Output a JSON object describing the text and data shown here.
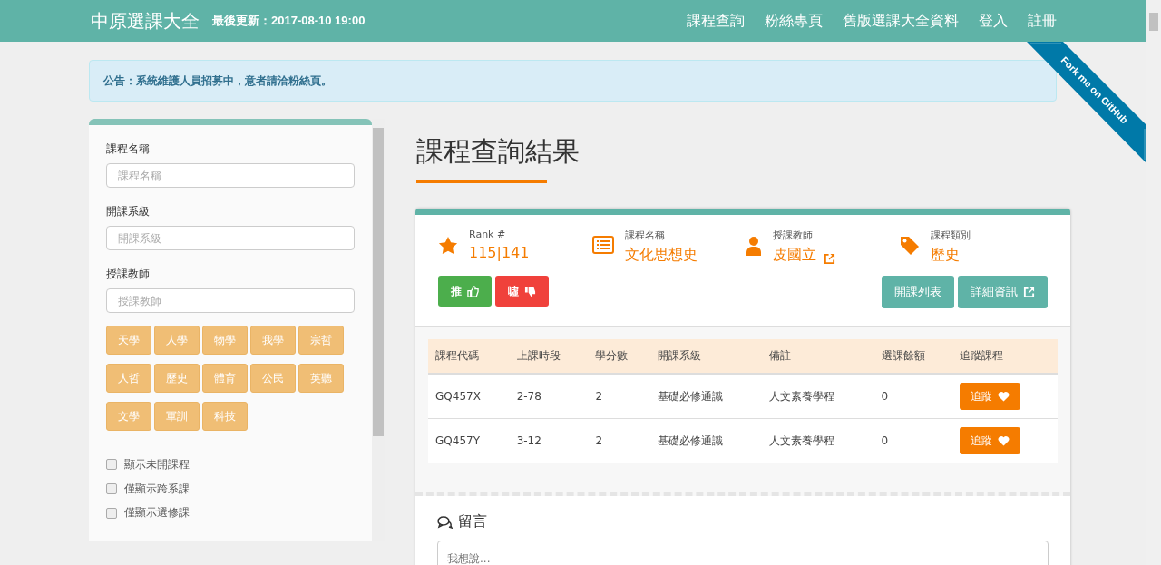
{
  "navbar": {
    "brand": "中原選課大全",
    "updated": "最後更新：2017-08-10 19:00",
    "links": [
      "課程查詢",
      "粉絲專頁",
      "舊版選課大全資料",
      "登入",
      "註冊"
    ]
  },
  "ribbon": {
    "text": "Fork me on GitHub"
  },
  "notice": "公告：系統維護人員招募中，意者請洽粉絲頁。",
  "sidebar": {
    "fields": [
      {
        "label": "課程名稱",
        "placeholder": "課程名稱"
      },
      {
        "label": "開課系級",
        "placeholder": "開課系級"
      },
      {
        "label": "授課教師",
        "placeholder": "授課教師"
      }
    ],
    "tags": [
      "天學",
      "人學",
      "物學",
      "我學",
      "宗哲",
      "人哲",
      "歷史",
      "體育",
      "公民",
      "英聽",
      "文學",
      "軍訓",
      "科技"
    ],
    "checkboxes": [
      {
        "label": "顯示未開課程",
        "checked": false
      },
      {
        "label": "僅顯示跨系課",
        "checked": false
      },
      {
        "label": "僅顯示選修課",
        "checked": false
      }
    ]
  },
  "main": {
    "title": "課程查詢結果",
    "info": [
      {
        "kind": "star",
        "label": "Rank #",
        "value": "115|141",
        "link": false
      },
      {
        "kind": "list",
        "label": "課程名稱",
        "value": "文化思想史",
        "link": false
      },
      {
        "kind": "person",
        "label": "授課教師",
        "value": "皮國立",
        "link": true
      },
      {
        "kind": "tag",
        "label": "課程類別",
        "value": "歷史",
        "link": false
      }
    ],
    "vote": {
      "up": "推",
      "down": "噓"
    },
    "actions": [
      {
        "label": "開課列表",
        "external": false
      },
      {
        "label": "詳細資訊",
        "external": true
      }
    ],
    "table": {
      "columns": [
        "課程代碼",
        "上課時段",
        "學分數",
        "開課系級",
        "備註",
        "選課餘額",
        "追蹤課程"
      ],
      "rows": [
        {
          "cells": [
            "GQ457X",
            "2-78",
            "2",
            "基礎必修通識",
            "人文素養學程",
            "0"
          ],
          "button": "追蹤"
        },
        {
          "cells": [
            "GQ457Y",
            "3-12",
            "2",
            "基礎必修通識",
            "人文素養學程",
            "0"
          ],
          "button": "追蹤"
        }
      ]
    },
    "comments": {
      "title": "留言",
      "placeholder": "我想說..."
    }
  }
}
